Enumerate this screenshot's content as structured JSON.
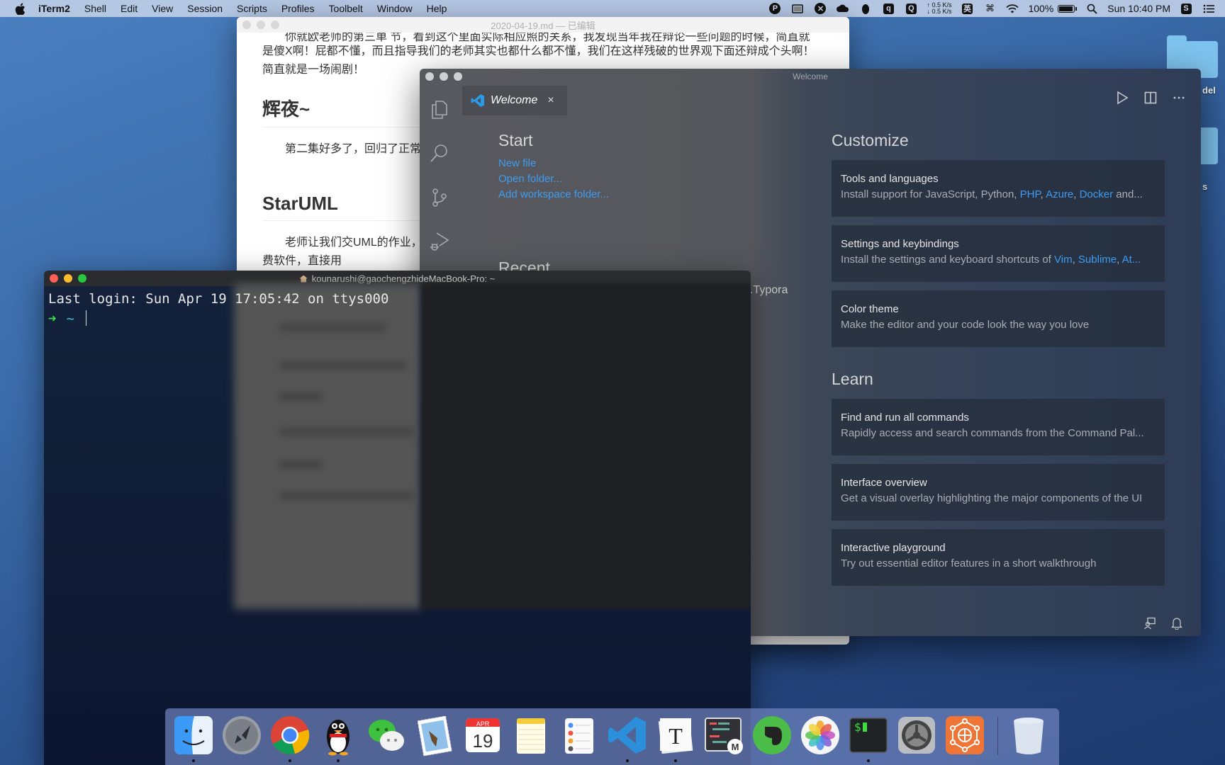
{
  "menubar": {
    "app_name": "iTerm2",
    "items": [
      "Shell",
      "Edit",
      "View",
      "Session",
      "Scripts",
      "Profiles",
      "Toolbelt",
      "Window",
      "Help"
    ],
    "status": {
      "net_up": "↑ 0.5 K/s",
      "net_down": "↓ 0.5 K/s",
      "ime": "英",
      "battery": "100%",
      "battery_level": 1.0,
      "clock": "Sun 10:40 PM"
    }
  },
  "desktop": {
    "labels": [
      "del",
      "s"
    ]
  },
  "typora": {
    "title": "2020-04-19.md — 已编辑",
    "para_top_cut": "你就欧老师的第三单 节，看到这个里面实际相应照的关系，我发现当年我在辩论一些问题的时候，简直就",
    "para_1": "是傻X啊！屁都不懂，而且指导我们的老师其实也都什么都不懂，我们在这样残破的世界观下面还辩成个头啊！",
    "para_1b": "简直就是一场闹剧！",
    "heading_1": "辉夜~",
    "para_2": "第二集好多了，回归了正常",
    "heading_2": "StarUML",
    "para_3": "老师让我们交UML的作业，",
    "para_3b": "费软件，直接用"
  },
  "vscode": {
    "window_title": "Welcome",
    "tab": {
      "label": "Welcome",
      "close": "×"
    },
    "start": {
      "heading": "Start",
      "links": [
        "New file",
        "Open folder...",
        "Add workspace folder..."
      ]
    },
    "recent": {
      "heading": "Recent",
      "items": [
        ".Typora"
      ]
    },
    "customize": {
      "heading": "Customize",
      "cards": [
        {
          "title": "Tools and languages",
          "desc_prefix": "Install support for JavaScript, Python, ",
          "links": [
            "PHP",
            "Azure",
            "Docker"
          ],
          "desc_suffix": " and..."
        },
        {
          "title": "Settings and keybindings",
          "desc_prefix": "Install the settings and keyboard shortcuts of ",
          "links": [
            "Vim",
            "Sublime",
            "At..."
          ],
          "desc_suffix": ""
        },
        {
          "title": "Color theme",
          "desc": "Make the editor and your code look the way you love"
        }
      ]
    },
    "learn": {
      "heading": "Learn",
      "cards": [
        {
          "title": "Find and run all commands",
          "desc": "Rapidly access and search commands from the Command Pal..."
        },
        {
          "title": "Interface overview",
          "desc": "Get a visual overlay highlighting the major components of the UI"
        },
        {
          "title": "Interactive playground",
          "desc": "Try out essential editor features in a short walkthrough"
        }
      ]
    },
    "colors": {
      "link": "#3d9cf0"
    }
  },
  "terminal": {
    "title": "kounarushi@gaochengzhideMacBook-Pro: ~",
    "last_login": "Last login: Sun Apr 19 17:05:42 on ttys000",
    "prompt_arrow": "➜",
    "prompt_dir": "~"
  },
  "dock": {
    "apps": [
      {
        "name": "Finder",
        "running": true
      },
      {
        "name": "Launchpad",
        "running": false
      },
      {
        "name": "Google Chrome",
        "running": true
      },
      {
        "name": "QQ",
        "running": true
      },
      {
        "name": "WeChat",
        "running": false
      },
      {
        "name": "Mail",
        "running": false
      },
      {
        "name": "Calendar",
        "running": false,
        "month": "APR",
        "day": "19"
      },
      {
        "name": "Notes",
        "running": false
      },
      {
        "name": "Reminders",
        "running": false
      },
      {
        "name": "Visual Studio Code",
        "running": true
      },
      {
        "name": "Typora",
        "running": true
      },
      {
        "name": "MWeb",
        "running": false
      },
      {
        "name": "Evernote",
        "running": false
      },
      {
        "name": "Photos",
        "running": false
      },
      {
        "name": "iTerm2",
        "running": true
      },
      {
        "name": "System Preferences",
        "running": false
      },
      {
        "name": "Network App",
        "running": false
      },
      {
        "name": "Trash",
        "running": false
      }
    ]
  }
}
